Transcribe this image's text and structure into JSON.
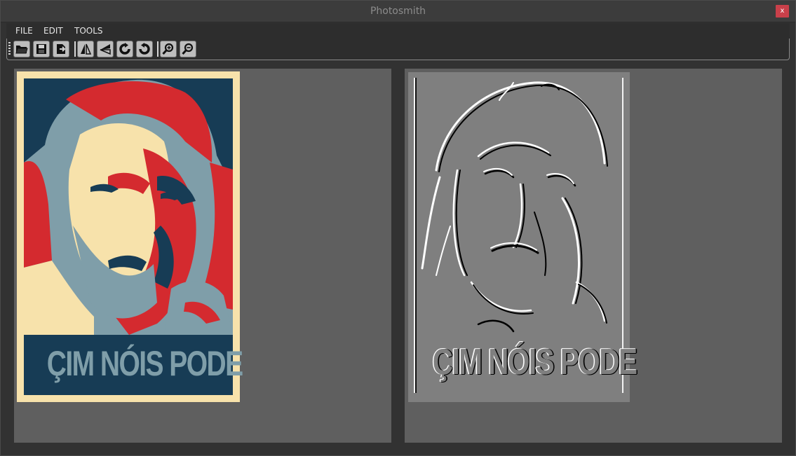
{
  "window": {
    "title": "Photosmith",
    "close_label": "x"
  },
  "menubar": {
    "items": [
      {
        "label": "FILE"
      },
      {
        "label": "EDIT"
      },
      {
        "label": "TOOLS"
      }
    ]
  },
  "toolbar": {
    "buttons": [
      {
        "icon": "open-folder-icon"
      },
      {
        "icon": "save-icon"
      },
      {
        "icon": "export-icon"
      },
      {
        "icon": "flip-horizontal-icon"
      },
      {
        "icon": "flip-vertical-icon"
      },
      {
        "icon": "rotate-clockwise-icon"
      },
      {
        "icon": "rotate-counterclockwise-icon"
      },
      {
        "icon": "zoom-in-icon"
      },
      {
        "icon": "zoom-out-icon"
      }
    ]
  },
  "original_image": {
    "caption": "ÇIM NÓIS PODE",
    "colors": {
      "background": "#f7e2ab",
      "navy": "#173c55",
      "red": "#d42a2f",
      "blue_gray": "#7f9ea9",
      "cream": "#f7e2ab"
    }
  },
  "processed_image": {
    "caption": "ÇIM NÓIS PODE",
    "colors": {
      "background": "#7f7f7f",
      "highlight": "#ffffff",
      "shadow": "#000000"
    }
  }
}
